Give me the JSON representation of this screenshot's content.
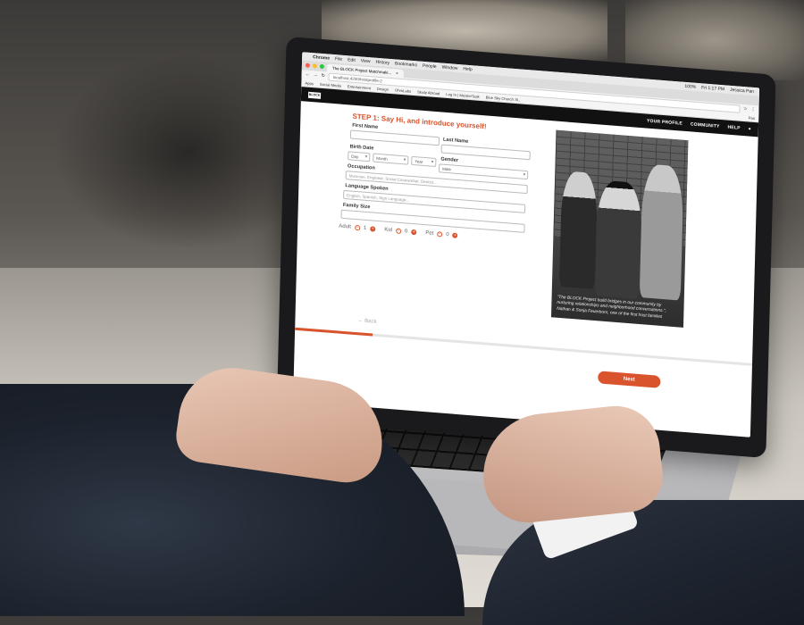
{
  "mac_menubar": {
    "app": "Chrome",
    "menus": [
      "File",
      "Edit",
      "View",
      "History",
      "Bookmarks",
      "People",
      "Window",
      "Help"
    ],
    "clock": "Fri 1:17 PM",
    "user": "Jessica Pan",
    "battery": "100%"
  },
  "browser": {
    "tab_title": "The BLOCK Project Matchmaki...",
    "url": "localhost:4200/hostprofile-2",
    "bookmarks": [
      "Apps",
      "Social Media",
      "Entertainment",
      "Design",
      "OhmLabs",
      "Study Abroad",
      "Log In | MeisterTask",
      "Blue Sky Church: B..."
    ],
    "profile_label": "Pan"
  },
  "site_nav": {
    "logo": "BLOCK",
    "links": [
      "YOUR PROFILE",
      "COMMUNITY",
      "HELP"
    ]
  },
  "form": {
    "step_title": "STEP 1: Say Hi, and introduce yourself!",
    "first_name_label": "First Name",
    "last_name_label": "Last Name",
    "birth_date_label": "Birth Date",
    "day_value": "Day",
    "month_value": "Month",
    "year_value": "Year",
    "gender_label": "Gender",
    "gender_value": "Male",
    "occupation_label": "Occupation",
    "occupation_placeholder": "Musician, Engineer, Social Caseworker, Dentist...",
    "language_label": "Language Spoken",
    "language_placeholder": "English, Spanish, Sign Language...",
    "family_size_label": "Family Size",
    "adult_label": "Adult",
    "adult_count": "1",
    "kid_label": "Kid",
    "kid_count": "0",
    "pet_label": "Pet",
    "pet_count": "0"
  },
  "photo_caption": "\"The BLOCK Project build bridges in our community by nurturing relationships and neighborhood conversations.\", Nathan & Sonja Feuerborn, one of the first host families",
  "footer": {
    "back_label": "Back",
    "next_label": "Next",
    "progress_fraction": 0.17
  },
  "colors": {
    "accent": "#d9532c",
    "nav_bg": "#111111"
  }
}
